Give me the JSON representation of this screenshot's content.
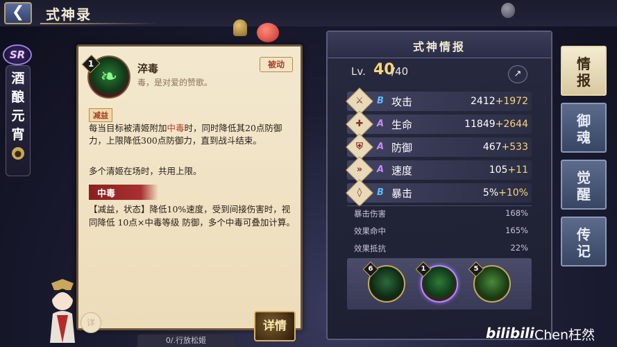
{
  "header": {
    "title": "式神录"
  },
  "character": {
    "rarity": "SR",
    "name": "酒酿元宵"
  },
  "skill": {
    "level": "1",
    "name": "淬毒",
    "desc": "毒，是对爱的赞歌。",
    "type": "被动",
    "tag": "减益",
    "effect_before": "每当目标被清姬附加",
    "effect_keyword": "中毒",
    "effect_after": "时，同时降低其20点防御力，上限降低300点防御力，直到战斗结束。",
    "effect2": "多个清姬在场时，共用上限。",
    "sub_title": "中毒",
    "sub_text": "【减益，状态】降低10%速度，受到间接伤害时，视同降低 10点×中毒等级 防御，多个中毒可叠加计算。",
    "detail_circle": "详",
    "detail_button": "详情",
    "bottom_strip": "0/.行放松姬"
  },
  "info": {
    "title": "式神情报",
    "lv_label": "Lv.",
    "lv_value": "40",
    "lv_max": "/40",
    "stats": [
      {
        "icon": "attack-icon",
        "grade": "B",
        "label": "攻击",
        "base": "2412",
        "bonus": "+1972"
      },
      {
        "icon": "hp-icon",
        "grade": "A",
        "label": "生命",
        "base": "11849",
        "bonus": "+2644"
      },
      {
        "icon": "defense-icon",
        "grade": "A",
        "label": "防御",
        "base": "467",
        "bonus": "+533"
      },
      {
        "icon": "speed-icon",
        "grade": "A",
        "label": "速度",
        "base": "105",
        "bonus": "+11"
      },
      {
        "icon": "crit-icon",
        "grade": "B",
        "label": "暴击",
        "base": "5%",
        "bonus": "+10%"
      }
    ],
    "sub_stats": [
      {
        "label": "暴击伤害",
        "value": "168%"
      },
      {
        "label": "效果命中",
        "value": "165%"
      },
      {
        "label": "效果抵抗",
        "value": "22%"
      }
    ],
    "skills": [
      {
        "level": "6",
        "icon": "snake-skill-icon"
      },
      {
        "level": "1",
        "icon": "poison-skill-icon"
      },
      {
        "level": "5",
        "icon": "toxic-skill-icon"
      }
    ]
  },
  "tabs": [
    {
      "label": "情报",
      "active": true
    },
    {
      "label": "御魂",
      "active": false
    },
    {
      "label": "觉醒",
      "active": false
    },
    {
      "label": "传记",
      "active": false
    }
  ],
  "watermark": {
    "logo": "bilibili",
    "name": "Chen枉然"
  },
  "colors": {
    "accent_gold": "#f8d678",
    "grade_b": "#5abcff",
    "grade_a": "#c88aff",
    "keyword_red": "#c0402a"
  }
}
